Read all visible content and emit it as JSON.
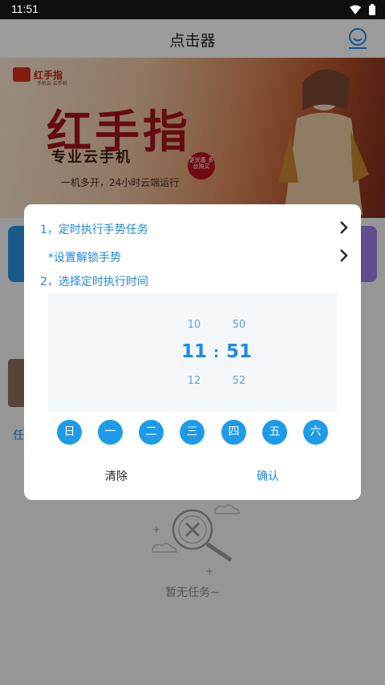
{
  "status_bar": {
    "time": "11:51",
    "icons": [
      "wifi-icon",
      "battery-icon"
    ]
  },
  "app_bar": {
    "title": "点击器",
    "right_icon": "user-profile-icon"
  },
  "banner": {
    "logo_name": "红手指",
    "logo_sub": "手机云·云手机",
    "big_title": "红手指",
    "sub_title": "专业云手机",
    "slogan": "一机多开，24小时云端运行",
    "badge": "更优惠 多台购买"
  },
  "background": {
    "side_text": "任",
    "empty_text": "暂无任务~"
  },
  "dialog": {
    "step1": "1，定时执行手势任务",
    "step1_sub": "*设置解锁手势",
    "step2": "2，选择定时执行时间",
    "hour": {
      "prev": "10",
      "current": "11",
      "next": "12"
    },
    "minute": {
      "prev": "50",
      "current": "51",
      "next": "52"
    },
    "colon": ":",
    "days": [
      "日",
      "一",
      "二",
      "三",
      "四",
      "五",
      "六"
    ],
    "clear_label": "清除",
    "confirm_label": "确认"
  },
  "colors": {
    "accent": "#1e88e5",
    "day_circle": "#1e9be8",
    "overlay": "rgba(0,0,0,0.38)"
  }
}
